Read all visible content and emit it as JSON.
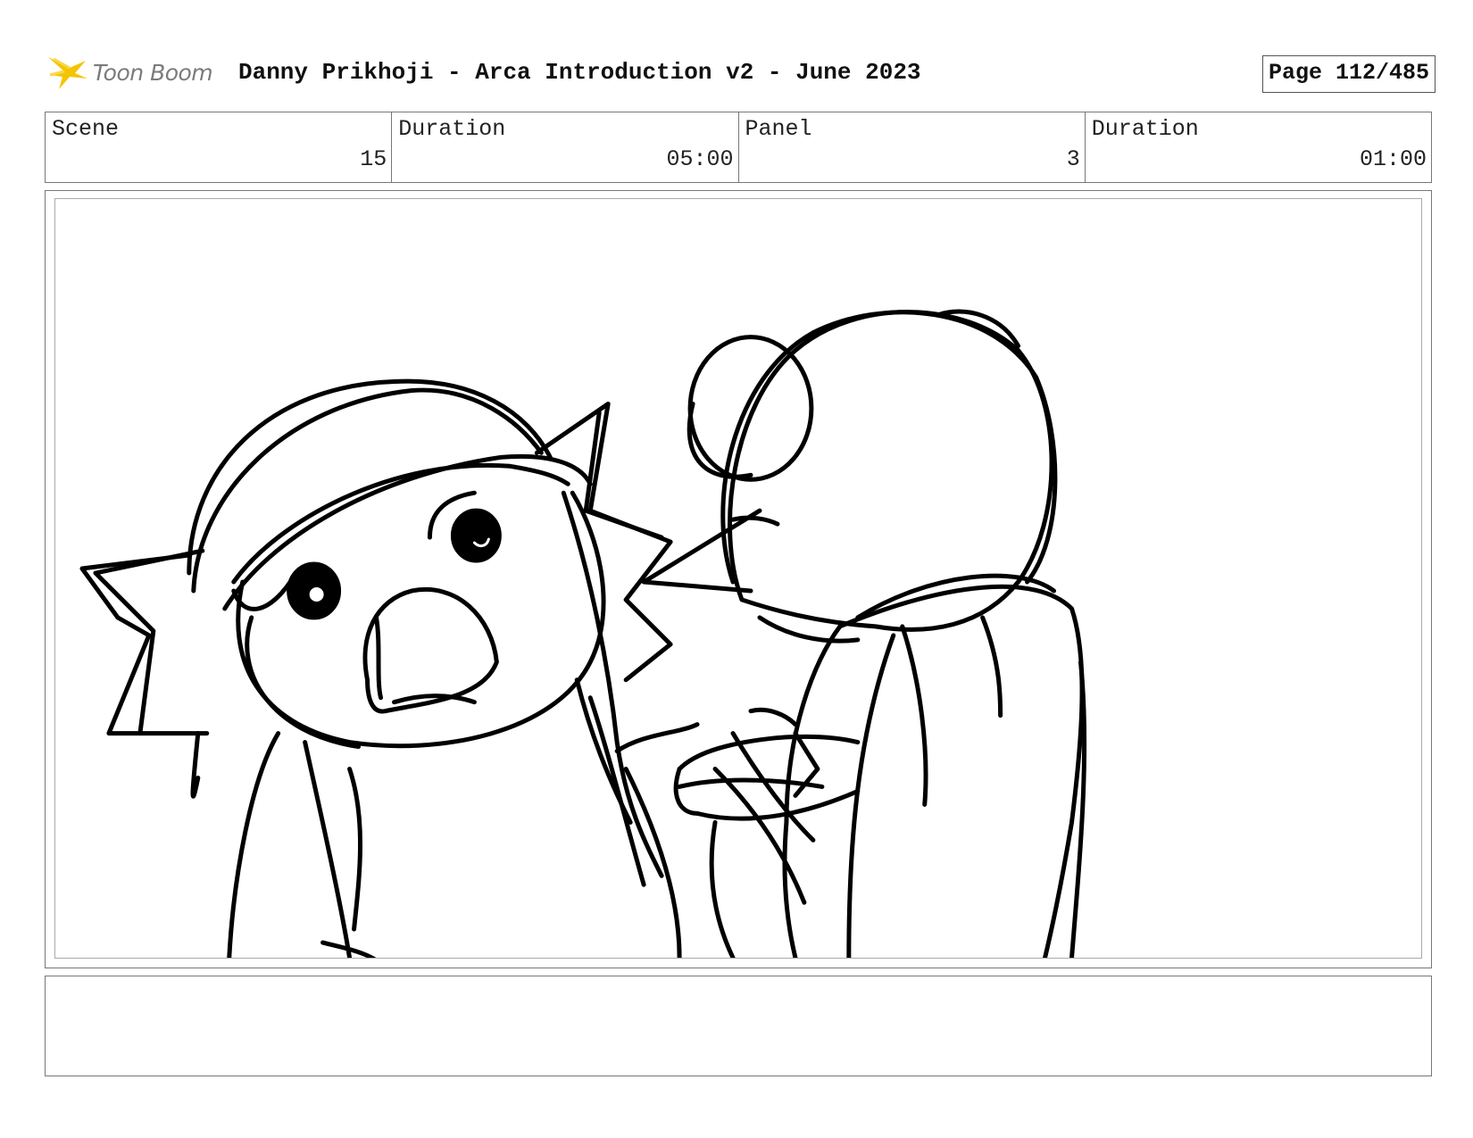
{
  "header": {
    "logo_text": "Toon Boom",
    "title": "Danny Prikhoji - Arca Introduction v2 - June 2023",
    "page": "Page 112/485"
  },
  "info": {
    "scene_label": "Scene",
    "scene_value": "15",
    "scene_duration_label": "Duration",
    "scene_duration_value": "05:00",
    "panel_label": "Panel",
    "panel_value": "3",
    "panel_duration_label": "Duration",
    "panel_duration_value": "01:00"
  },
  "colors": {
    "logo_star": "#f5c400",
    "logo_text": "#7b7b7b",
    "sketch_ink": "#000000"
  },
  "icons": {
    "logo": "toon-boom-star-icon"
  }
}
